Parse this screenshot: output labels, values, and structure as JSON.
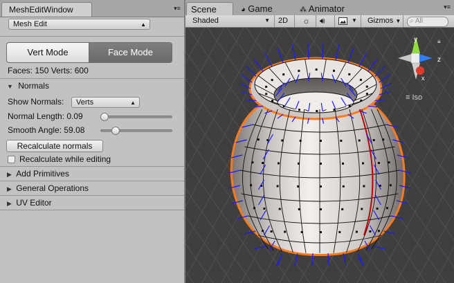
{
  "left_window": {
    "tab_title": "MeshEditWindow",
    "mode_popup": "Mesh Edit",
    "vert_mode_label": "Vert Mode",
    "face_mode_label": "Face Mode",
    "stats": "Faces: 150 Verts: 600",
    "normals_header": "Normals",
    "show_normals_label": "Show Normals:",
    "show_normals_value": "Verts",
    "normal_length_label": "Normal Length: 0.09",
    "normal_length_fraction": 0.02,
    "smooth_angle_label": "Smooth Angle: 59.08",
    "smooth_angle_fraction": 0.17,
    "recalculate_button": "Recalculate normals",
    "recalc_while_editing_label": "Recalculate while editing",
    "recalc_while_editing_checked": false,
    "sections": [
      "Add Primitives",
      "General Operations",
      "UV Editor"
    ]
  },
  "scene_window": {
    "tabs": [
      {
        "label": "Scene",
        "icon": "scene-icon",
        "active": true
      },
      {
        "label": "Game",
        "icon": "game-icon",
        "active": false
      },
      {
        "label": "Animator",
        "icon": "animator-icon",
        "active": false
      }
    ],
    "toolbar": {
      "shading": "Shaded",
      "mode_2d": "2D",
      "gizmos": "Gizmos",
      "search_placeholder": "All"
    },
    "gizmo": {
      "y": "y",
      "z": "z",
      "x": "x",
      "projection": "Iso"
    }
  },
  "colors": {
    "selection_outline": "#ff7a1a",
    "normals": "#1a1aff",
    "grid_bg": "#3f3f3f",
    "mesh_face": "#d7d2cf"
  }
}
